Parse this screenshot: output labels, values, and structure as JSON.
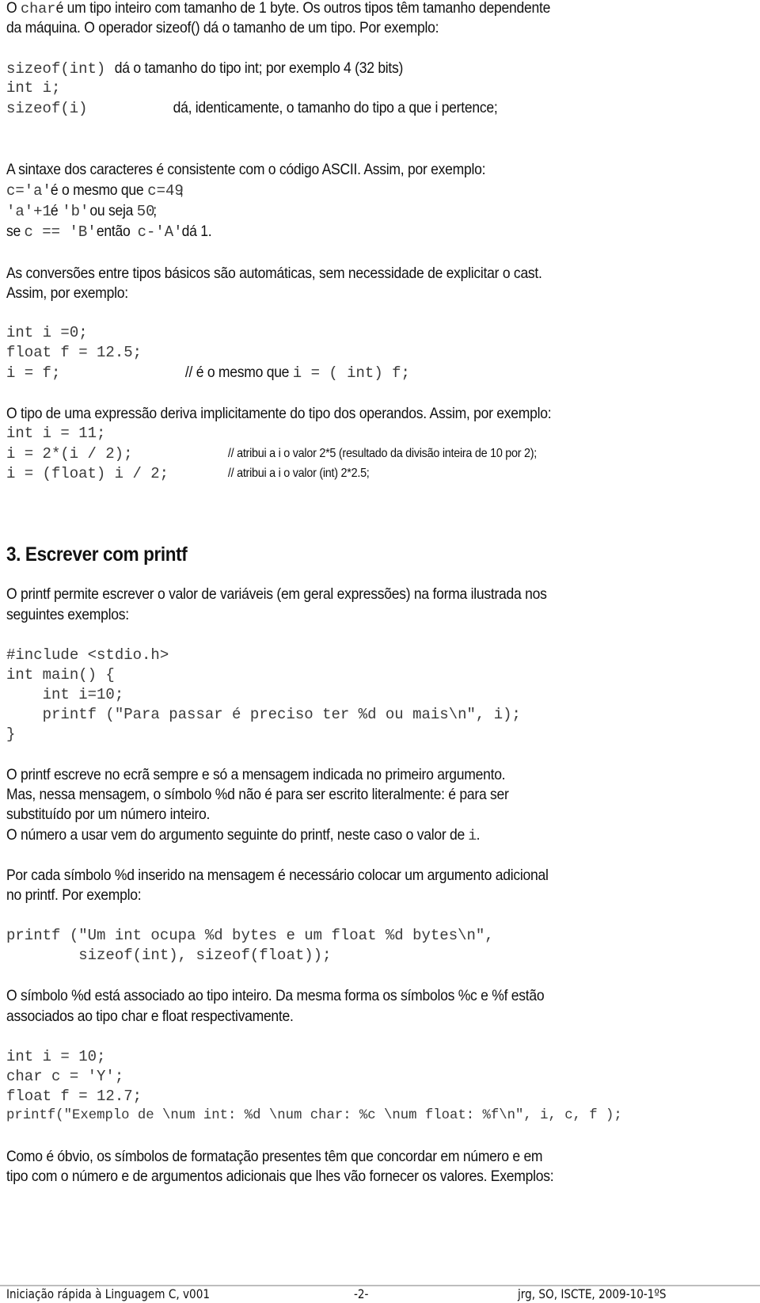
{
  "intro": {
    "p1_l1_a": "O ",
    "p1_l1_code": "char",
    "p1_l1_b": " é um tipo inteiro com tamanho de 1 byte. Os outros tipos têm tamanho dependente",
    "p1_l2": "da máquina. O operador sizeof() dá o tamanho de um tipo. Por exemplo:"
  },
  "sizeof_example": {
    "l1_code": "sizeof(int)",
    "l1_text": "dá o tamanho do tipo int; por exemplo 4 (32 bits)",
    "l2_code": "int i;",
    "l3_code": "sizeof(i)",
    "l3_text": "dá, identicamente, o tamanho do tipo a que i pertence;"
  },
  "ascii": {
    "intro": "A sintaxe dos caracteres é consistente com o código ASCII. Assim, por exemplo:",
    "l1": [
      {
        "t": "c='a'",
        "code": true
      },
      {
        "t": " é o mesmo que ",
        "code": false
      },
      {
        "t": "c=49",
        "code": true
      },
      {
        "t": ";",
        "code": false
      }
    ],
    "l2": [
      {
        "t": "'a'+1",
        "code": true
      },
      {
        "t": " é ",
        "code": false
      },
      {
        "t": "'b'",
        "code": true
      },
      {
        "t": " ou seja ",
        "code": false
      },
      {
        "t": "50",
        "code": true
      },
      {
        "t": ";",
        "code": false
      }
    ],
    "l3": [
      {
        "t": "se ",
        "code": false
      },
      {
        "t": "c == 'B'",
        "code": true
      },
      {
        "t": "  então  ",
        "code": false
      },
      {
        "t": "c-'A'",
        "code": true
      },
      {
        "t": " dá 1.",
        "code": false
      }
    ]
  },
  "conversions": {
    "l1": "As conversões entre tipos básicos são automáticas, sem necessidade de explicitar o cast.",
    "l2": "Assim, por exemplo:",
    "code1": "int i =0;",
    "code2": "float f = 12.5;",
    "code3": "i = f;",
    "comment_text": "// é o mesmo que ",
    "comment_code": "i = ( int) f;"
  },
  "expression_type": {
    "intro": "O tipo de uma expressão deriva implicitamente do tipo dos operandos. Assim, por exemplo:",
    "code1": "int i = 11;",
    "code2": "i = 2*(i / 2);",
    "comment2": "// atribui a i o valor 2*5 (resultado da divisão inteira de 10 por 2);",
    "code3": "i = (float) i / 2;",
    "comment3": "// atribui a i o valor (int) 2*2.5;"
  },
  "section3": {
    "heading": "3. Escrever com printf",
    "intro_l1": "O printf permite escrever o valor de variáveis (em geral expressões) na forma ilustrada nos",
    "intro_l2": "seguintes exemplos:",
    "code": [
      "#include <stdio.h>",
      "int main() {",
      "    int i=10;",
      "    printf (\"Para passar é preciso ter %d ou mais\\n\", i);",
      "}"
    ],
    "explain_l1": "O printf escreve no ecrã sempre e só a mensagem indicada no primeiro argumento.",
    "explain_l2": "Mas, nessa mensagem, o símbolo %d não é para ser escrito literalmente: é para ser",
    "explain_l3": "substituído por um número inteiro.",
    "explain_l4_text": "O número a usar vem do argumento seguinte do printf, neste caso o valor de ",
    "explain_l4_code": "i",
    "explain_l4_end": ".",
    "each_l1": "Por cada símbolo %d inserido na mensagem é necessário colocar um argumento adicional",
    "each_l2": "no printf. Por exemplo:",
    "code2": [
      "printf (\"Um int ocupa %d bytes e um float %d bytes\\n\",",
      "        sizeof(int), sizeof(float));"
    ],
    "symbols_l1": "O símbolo %d está associado ao tipo inteiro. Da mesma forma os símbolos %c e %f estão",
    "symbols_l2": "associados ao tipo char e float respectivamente.",
    "code3": [
      "int i = 10;",
      "char c = 'Y';",
      "float f = 12.7;"
    ],
    "code3_printf": "printf(\"Exemplo de \\num int: %d \\num char: %c \\num float: %f\\n\", i, c, f );",
    "final_l1": "Como é óbvio, os símbolos de formatação presentes têm que concordar em número e em",
    "final_l2": "tipo com o número e de argumentos adicionais que lhes vão fornecer os valores. Exemplos:"
  },
  "footer": {
    "left": "Iniciação rápida à Linguagem C, v001",
    "center": "-2-",
    "right": "jrg, SO, ISCTE, 2009-10-1ºS"
  }
}
